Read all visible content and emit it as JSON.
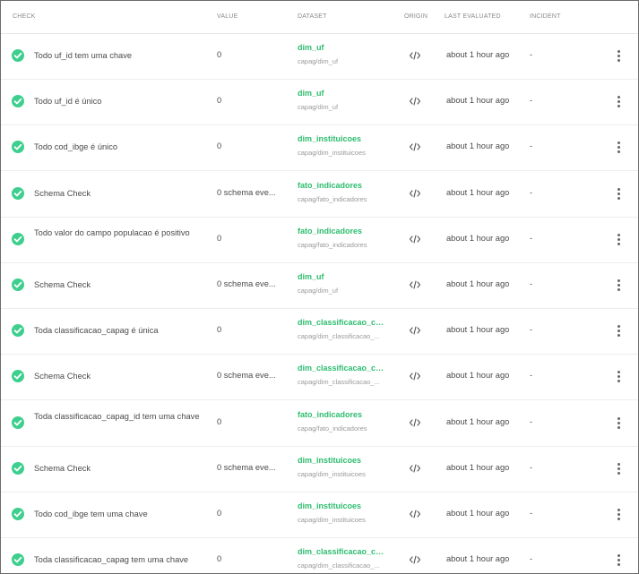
{
  "columns": {
    "check": "CHECK",
    "value": "VALUE",
    "dataset": "DATASET",
    "origin": "ORIGIN",
    "last_evaluated": "LAST EVALUATED",
    "incident": "INCIDENT"
  },
  "colors": {
    "status_pass": "#3ecf8e",
    "dataset_link": "#2dbd6e"
  },
  "icons": {
    "status": "check-circle-icon",
    "origin": "code-icon",
    "menu": "more-vertical-icon"
  },
  "rows": [
    {
      "check": "Todo uf_id tem uma chave",
      "value": "0",
      "dataset": "dim_uf",
      "dataset_path": "capag/dim_uf",
      "evaluated": "about 1 hour ago",
      "incident": "-"
    },
    {
      "check": "Todo uf_id é único",
      "value": "0",
      "dataset": "dim_uf",
      "dataset_path": "capag/dim_uf",
      "evaluated": "about 1 hour ago",
      "incident": "-"
    },
    {
      "check": "Todo cod_ibge é único",
      "value": "0",
      "dataset": "dim_instituicoes",
      "dataset_path": "capag/dim_instituicoes",
      "evaluated": "about 1 hour ago",
      "incident": "-"
    },
    {
      "check": "Schema Check",
      "value": "0 schema eve...",
      "dataset": "fato_indicadores",
      "dataset_path": "capag/fato_indicadores",
      "evaluated": "about 1 hour ago",
      "incident": "-"
    },
    {
      "check": "Todo valor do campo populacao é positivo",
      "value": "0",
      "dataset": "fato_indicadores",
      "dataset_path": "capag/fato_indicadores",
      "evaluated": "about 1 hour ago",
      "incident": "-"
    },
    {
      "check": "Schema Check",
      "value": "0 schema eve...",
      "dataset": "dim_uf",
      "dataset_path": "capag/dim_uf",
      "evaluated": "about 1 hour ago",
      "incident": "-"
    },
    {
      "check": "Toda classificacao_capag é única",
      "value": "0",
      "dataset": "dim_classificacao_ca...",
      "dataset_path": "capag/dim_classificacao_...",
      "evaluated": "about 1 hour ago",
      "incident": "-"
    },
    {
      "check": "Schema Check",
      "value": "0 schema eve...",
      "dataset": "dim_classificacao_ca...",
      "dataset_path": "capag/dim_classificacao_...",
      "evaluated": "about 1 hour ago",
      "incident": "-"
    },
    {
      "check": "Toda classificacao_capag_id tem uma chave",
      "value": "0",
      "dataset": "fato_indicadores",
      "dataset_path": "capag/fato_indicadores",
      "evaluated": "about 1 hour ago",
      "incident": "-"
    },
    {
      "check": "Schema Check",
      "value": "0 schema eve...",
      "dataset": "dim_instituicoes",
      "dataset_path": "capag/dim_instituicoes",
      "evaluated": "about 1 hour ago",
      "incident": "-"
    },
    {
      "check": "Todo cod_ibge tem uma chave",
      "value": "0",
      "dataset": "dim_instituicoes",
      "dataset_path": "capag/dim_instituicoes",
      "evaluated": "about 1 hour ago",
      "incident": "-"
    },
    {
      "check": "Toda classificacao_capag tem uma chave",
      "value": "0",
      "dataset": "dim_classificacao_ca...",
      "dataset_path": "capag/dim_classificacao_...",
      "evaluated": "about 1 hour ago",
      "incident": "-"
    }
  ]
}
